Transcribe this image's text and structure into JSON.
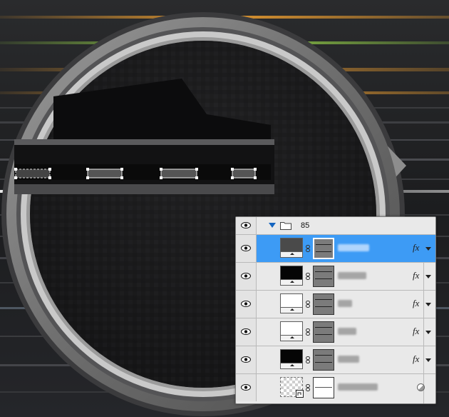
{
  "layers_panel": {
    "group": {
      "name": "85",
      "expanded": true,
      "icons": [
        "eye-icon",
        "disclosure-triangle-icon",
        "folder-icon"
      ]
    },
    "layers": [
      {
        "thumb_color": "#4a4a4a",
        "selected": true,
        "has_fx": true,
        "fx_label": "fx"
      },
      {
        "thumb_color": "#050505",
        "selected": false,
        "has_fx": true,
        "fx_label": "fx"
      },
      {
        "thumb_color": "#ffffff",
        "selected": false,
        "has_fx": true,
        "fx_label": "fx"
      },
      {
        "thumb_color": "#ffffff",
        "selected": false,
        "has_fx": true,
        "fx_label": "fx"
      },
      {
        "thumb_color": "#050505",
        "selected": false,
        "has_fx": true,
        "fx_label": "fx"
      },
      {
        "thumb_color": "transparent",
        "selected": false,
        "has_fx": false,
        "icon": "smart-object-icon"
      }
    ],
    "selection_color": "#3d9bf5"
  },
  "canvas": {
    "background_color": "#1e1f21",
    "stripe_colors": [
      "#f0a030",
      "#9ee04a",
      "#e07820",
      "#ffffff"
    ]
  }
}
